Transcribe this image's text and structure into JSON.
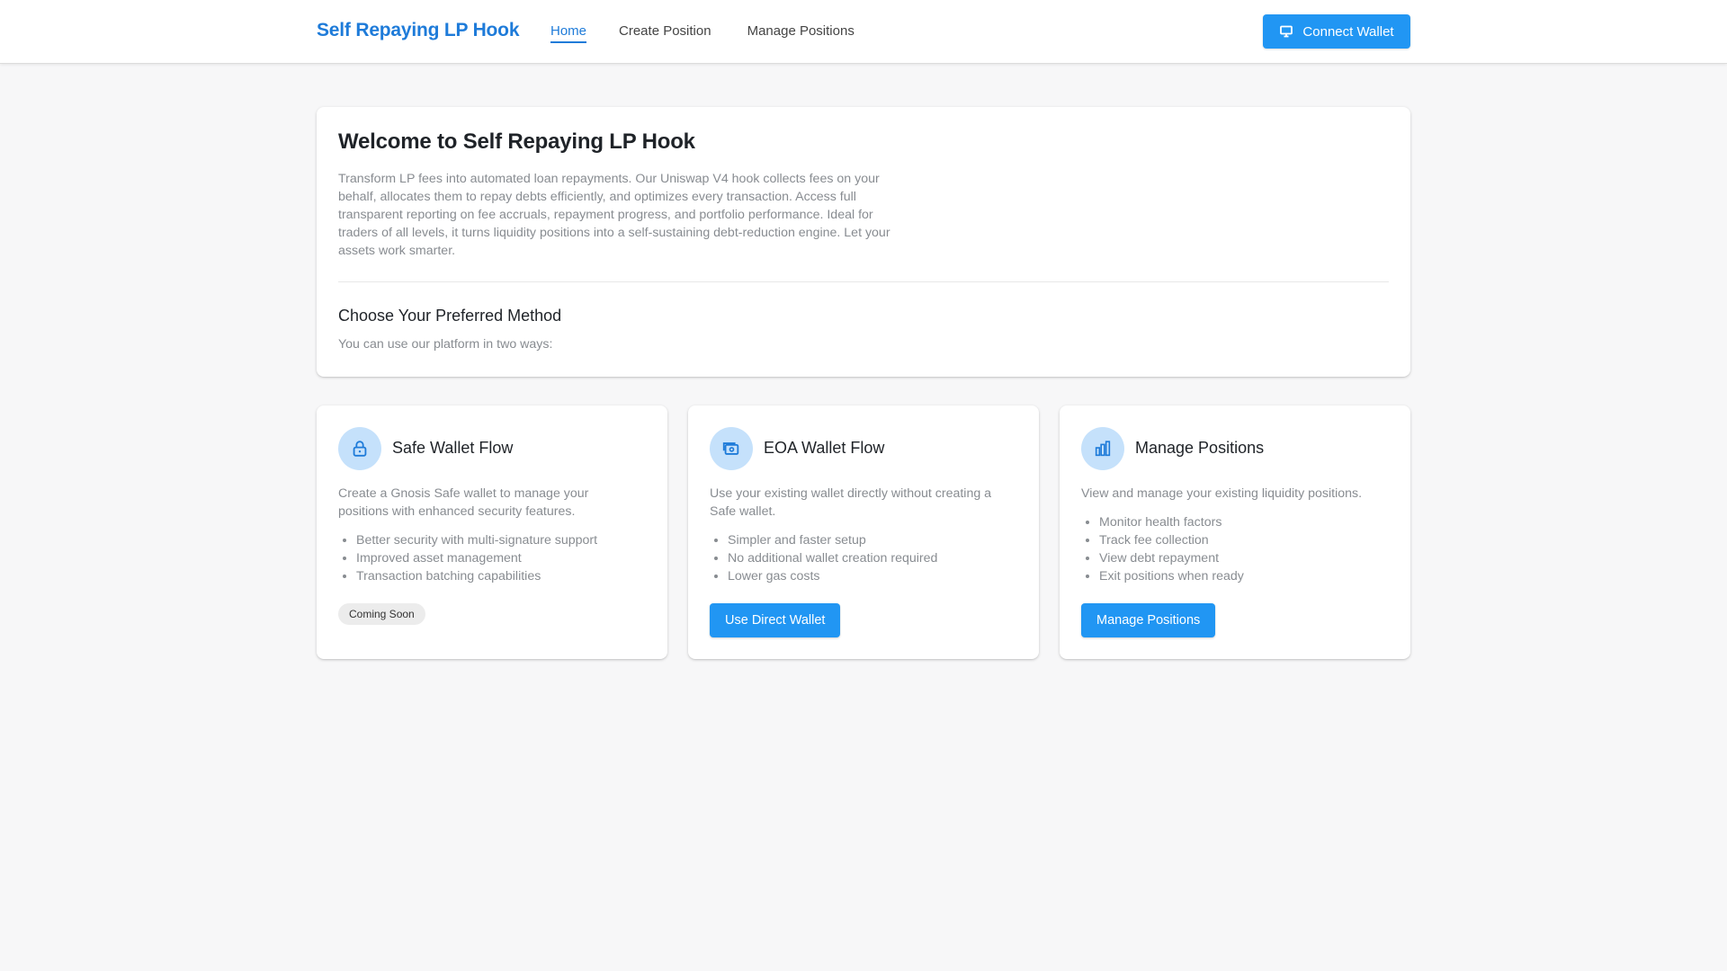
{
  "header": {
    "brand": "Self Repaying LP Hook",
    "nav": [
      {
        "label": "Home",
        "active": true
      },
      {
        "label": "Create Position",
        "active": false
      },
      {
        "label": "Manage Positions",
        "active": false
      }
    ],
    "connect_label": "Connect Wallet"
  },
  "welcome": {
    "title": "Welcome to Self Repaying LP Hook",
    "intro_lines": [
      "Transform LP fees into automated loan repayments. Our Uniswap V4 hook collects fees on your",
      "behalf, allocates them to repay debts efficiently, and optimizes every transaction. Access full",
      "transparent reporting on fee accruals, repayment progress, and portfolio performance. Ideal for",
      "traders of all levels, it turns liquidity positions into a self-sustaining debt-reduction engine. Let your",
      "assets work smarter."
    ],
    "method_title": "Choose Your Preferred Method",
    "method_sub": "You can use our platform in two ways:"
  },
  "cards": [
    {
      "icon": "lock-icon",
      "title": "Safe Wallet Flow",
      "desc_lines": [
        "Create a Gnosis Safe wallet to manage your",
        "positions with enhanced security features."
      ],
      "bullets": [
        "Better security with multi-signature support",
        "Improved asset management",
        "Transaction batching capabilities"
      ],
      "badge": "Coming Soon"
    },
    {
      "icon": "wallet-icon",
      "title": "EOA Wallet Flow",
      "desc_lines": [
        "Use your existing wallet directly without creating a",
        "Safe wallet."
      ],
      "bullets": [
        "Simpler and faster setup",
        "No additional wallet creation required",
        "Lower gas costs"
      ],
      "button": "Use Direct Wallet"
    },
    {
      "icon": "bar-chart-icon",
      "title": "Manage Positions",
      "desc_lines": [
        "View and manage your existing liquidity positions."
      ],
      "bullets": [
        "Monitor health factors",
        "Track fee collection",
        "View debt repayment",
        "Exit positions when ready"
      ],
      "button": "Manage Positions"
    }
  ],
  "colors": {
    "accent": "#2196f3",
    "brand": "#1e7bd9",
    "icon_bg": "#c5e1fb",
    "muted_text": "#888c91"
  }
}
